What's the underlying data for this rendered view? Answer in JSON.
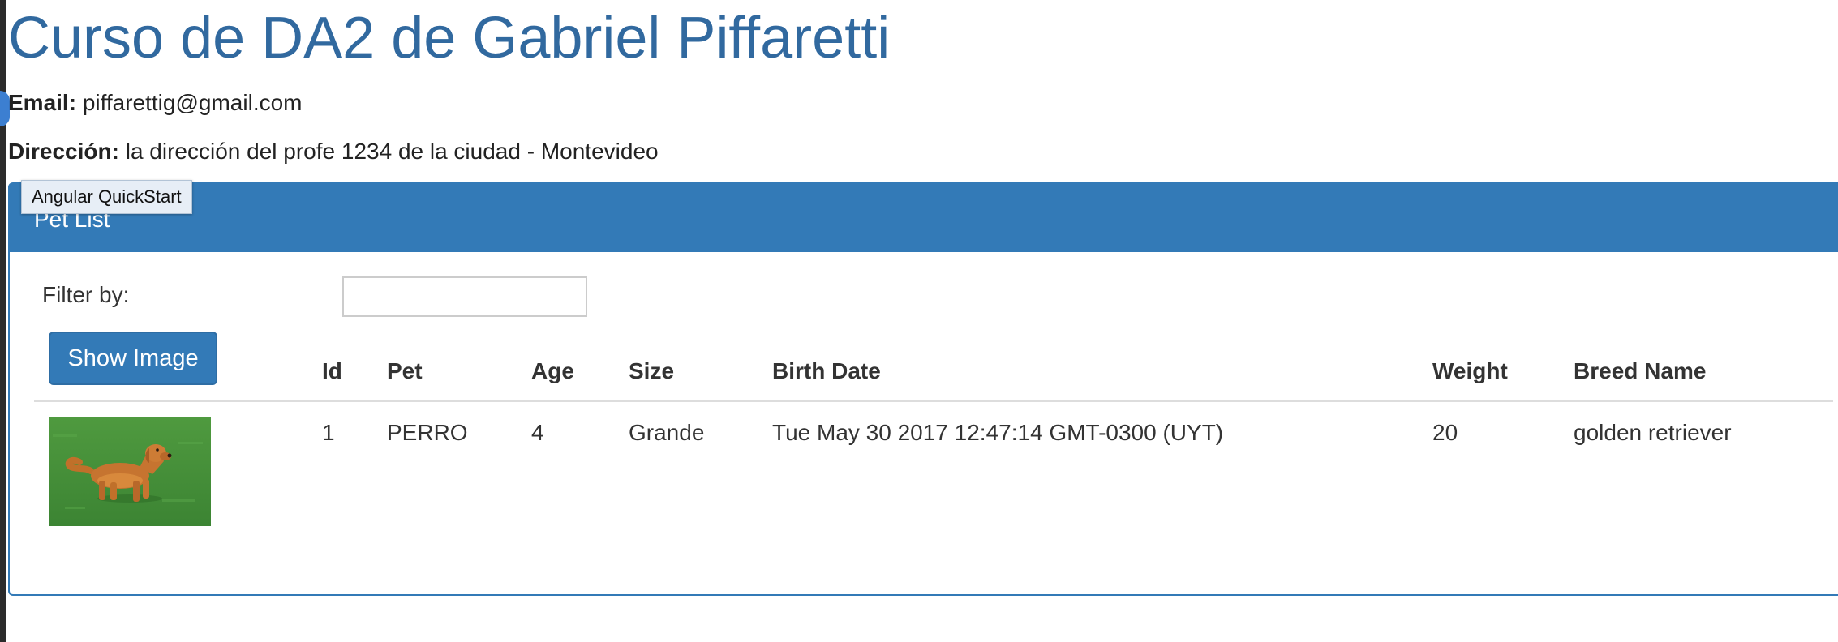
{
  "header": {
    "title": "Curso de DA2 de Gabriel Piffaretti",
    "email_label": "Email:",
    "email_value": "piffarettig@gmail.com",
    "address_label": "Dirección:",
    "address_value": "la dirección del profe 1234 de la ciudad - Montevideo"
  },
  "tooltip": {
    "text": "Angular QuickStart"
  },
  "panel": {
    "title": "Pet List",
    "filter_label": "Filter by:",
    "filter_value": "",
    "filter_placeholder": "",
    "show_image_label": "Show Image"
  },
  "table": {
    "columns": [
      "Id",
      "Pet",
      "Age",
      "Size",
      "Birth Date",
      "Weight",
      "Breed Name"
    ],
    "rows": [
      {
        "image": "golden-retriever-photo",
        "cells": [
          "1",
          "PERRO",
          "4",
          "Grande",
          "Tue May 30 2017 12:47:14 GMT-0300 (UYT)",
          "20",
          "golden retriever"
        ]
      }
    ]
  },
  "colors": {
    "primary": "#337ab7",
    "title": "#31699f",
    "text": "#333333",
    "border": "#dddddd"
  }
}
